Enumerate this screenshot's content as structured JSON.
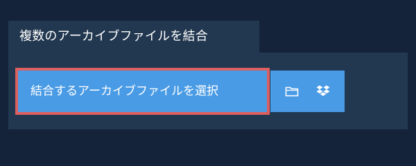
{
  "section": {
    "tab_title": "複数のアーカイブファイルを結合"
  },
  "upload": {
    "select_label": "結合するアーカイブファイルを選択",
    "icons": {
      "folder": "folder-icon",
      "dropbox": "dropbox-icon"
    }
  },
  "colors": {
    "page_background": "#14233a",
    "panel_background": "#223850",
    "button_blue": "#4a9be5",
    "focus_border": "#dd5f5f",
    "text": "#ffffff"
  }
}
